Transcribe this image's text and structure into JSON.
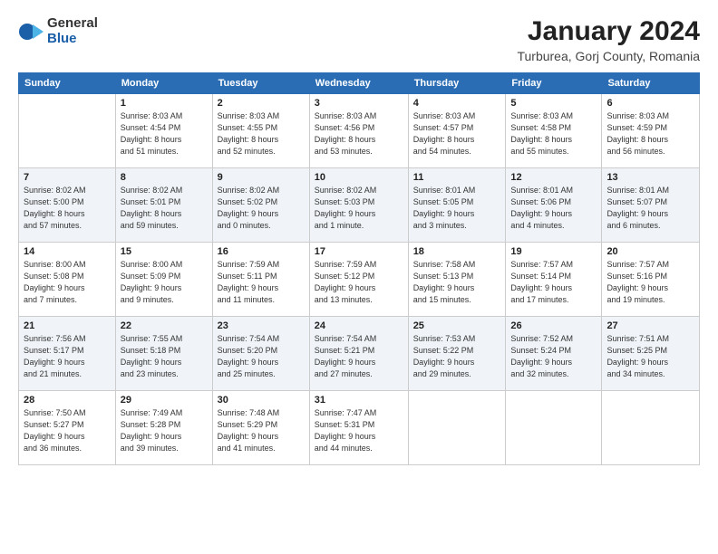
{
  "logo": {
    "general": "General",
    "blue": "Blue"
  },
  "title": {
    "month": "January 2024",
    "location": "Turburea, Gorj County, Romania"
  },
  "weekdays": [
    "Sunday",
    "Monday",
    "Tuesday",
    "Wednesday",
    "Thursday",
    "Friday",
    "Saturday"
  ],
  "weeks": [
    [
      {
        "day": "",
        "info": ""
      },
      {
        "day": "1",
        "info": "Sunrise: 8:03 AM\nSunset: 4:54 PM\nDaylight: 8 hours\nand 51 minutes."
      },
      {
        "day": "2",
        "info": "Sunrise: 8:03 AM\nSunset: 4:55 PM\nDaylight: 8 hours\nand 52 minutes."
      },
      {
        "day": "3",
        "info": "Sunrise: 8:03 AM\nSunset: 4:56 PM\nDaylight: 8 hours\nand 53 minutes."
      },
      {
        "day": "4",
        "info": "Sunrise: 8:03 AM\nSunset: 4:57 PM\nDaylight: 8 hours\nand 54 minutes."
      },
      {
        "day": "5",
        "info": "Sunrise: 8:03 AM\nSunset: 4:58 PM\nDaylight: 8 hours\nand 55 minutes."
      },
      {
        "day": "6",
        "info": "Sunrise: 8:03 AM\nSunset: 4:59 PM\nDaylight: 8 hours\nand 56 minutes."
      }
    ],
    [
      {
        "day": "7",
        "info": "Sunrise: 8:02 AM\nSunset: 5:00 PM\nDaylight: 8 hours\nand 57 minutes."
      },
      {
        "day": "8",
        "info": "Sunrise: 8:02 AM\nSunset: 5:01 PM\nDaylight: 8 hours\nand 59 minutes."
      },
      {
        "day": "9",
        "info": "Sunrise: 8:02 AM\nSunset: 5:02 PM\nDaylight: 9 hours\nand 0 minutes."
      },
      {
        "day": "10",
        "info": "Sunrise: 8:02 AM\nSunset: 5:03 PM\nDaylight: 9 hours\nand 1 minute."
      },
      {
        "day": "11",
        "info": "Sunrise: 8:01 AM\nSunset: 5:05 PM\nDaylight: 9 hours\nand 3 minutes."
      },
      {
        "day": "12",
        "info": "Sunrise: 8:01 AM\nSunset: 5:06 PM\nDaylight: 9 hours\nand 4 minutes."
      },
      {
        "day": "13",
        "info": "Sunrise: 8:01 AM\nSunset: 5:07 PM\nDaylight: 9 hours\nand 6 minutes."
      }
    ],
    [
      {
        "day": "14",
        "info": "Sunrise: 8:00 AM\nSunset: 5:08 PM\nDaylight: 9 hours\nand 7 minutes."
      },
      {
        "day": "15",
        "info": "Sunrise: 8:00 AM\nSunset: 5:09 PM\nDaylight: 9 hours\nand 9 minutes."
      },
      {
        "day": "16",
        "info": "Sunrise: 7:59 AM\nSunset: 5:11 PM\nDaylight: 9 hours\nand 11 minutes."
      },
      {
        "day": "17",
        "info": "Sunrise: 7:59 AM\nSunset: 5:12 PM\nDaylight: 9 hours\nand 13 minutes."
      },
      {
        "day": "18",
        "info": "Sunrise: 7:58 AM\nSunset: 5:13 PM\nDaylight: 9 hours\nand 15 minutes."
      },
      {
        "day": "19",
        "info": "Sunrise: 7:57 AM\nSunset: 5:14 PM\nDaylight: 9 hours\nand 17 minutes."
      },
      {
        "day": "20",
        "info": "Sunrise: 7:57 AM\nSunset: 5:16 PM\nDaylight: 9 hours\nand 19 minutes."
      }
    ],
    [
      {
        "day": "21",
        "info": "Sunrise: 7:56 AM\nSunset: 5:17 PM\nDaylight: 9 hours\nand 21 minutes."
      },
      {
        "day": "22",
        "info": "Sunrise: 7:55 AM\nSunset: 5:18 PM\nDaylight: 9 hours\nand 23 minutes."
      },
      {
        "day": "23",
        "info": "Sunrise: 7:54 AM\nSunset: 5:20 PM\nDaylight: 9 hours\nand 25 minutes."
      },
      {
        "day": "24",
        "info": "Sunrise: 7:54 AM\nSunset: 5:21 PM\nDaylight: 9 hours\nand 27 minutes."
      },
      {
        "day": "25",
        "info": "Sunrise: 7:53 AM\nSunset: 5:22 PM\nDaylight: 9 hours\nand 29 minutes."
      },
      {
        "day": "26",
        "info": "Sunrise: 7:52 AM\nSunset: 5:24 PM\nDaylight: 9 hours\nand 32 minutes."
      },
      {
        "day": "27",
        "info": "Sunrise: 7:51 AM\nSunset: 5:25 PM\nDaylight: 9 hours\nand 34 minutes."
      }
    ],
    [
      {
        "day": "28",
        "info": "Sunrise: 7:50 AM\nSunset: 5:27 PM\nDaylight: 9 hours\nand 36 minutes."
      },
      {
        "day": "29",
        "info": "Sunrise: 7:49 AM\nSunset: 5:28 PM\nDaylight: 9 hours\nand 39 minutes."
      },
      {
        "day": "30",
        "info": "Sunrise: 7:48 AM\nSunset: 5:29 PM\nDaylight: 9 hours\nand 41 minutes."
      },
      {
        "day": "31",
        "info": "Sunrise: 7:47 AM\nSunset: 5:31 PM\nDaylight: 9 hours\nand 44 minutes."
      },
      {
        "day": "",
        "info": ""
      },
      {
        "day": "",
        "info": ""
      },
      {
        "day": "",
        "info": ""
      }
    ]
  ]
}
